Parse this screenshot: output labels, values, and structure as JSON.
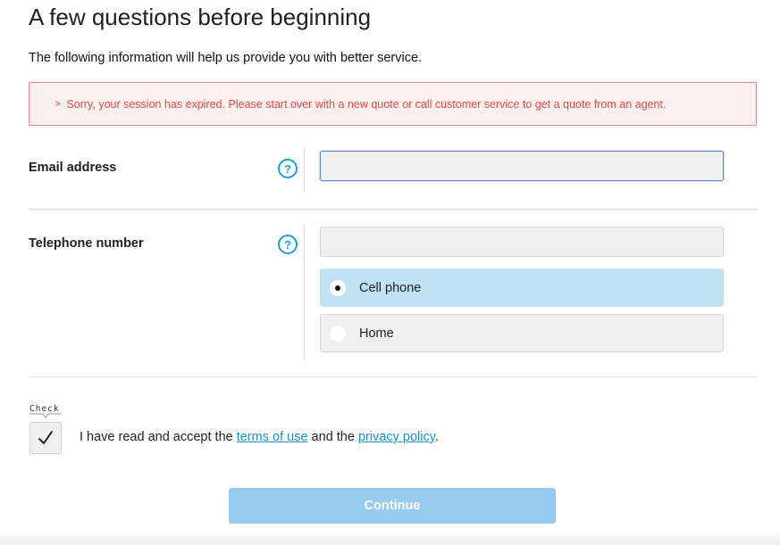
{
  "header": {
    "title": "A few questions before beginning",
    "intro": "The following information will help us provide you with better service."
  },
  "alert": {
    "message": "Sorry, your session has expired. Please start over with a new quote or call customer service to get a quote from an agent.",
    "color": "#e24a4a"
  },
  "email": {
    "label": "Email address",
    "value": "",
    "help_icon": "question-circle-icon"
  },
  "phone": {
    "label": "Telephone number",
    "value": "",
    "help_icon": "question-circle-icon",
    "options": [
      {
        "label": "Cell phone",
        "selected": true
      },
      {
        "label": "Home",
        "selected": false
      }
    ]
  },
  "consent": {
    "tag": "Check",
    "checked": true,
    "text_before": "I have read and accept the ",
    "terms_link": "terms of use",
    "text_middle": " and the ",
    "privacy_link": "privacy policy",
    "text_after": "."
  },
  "actions": {
    "continue_label": "Continue",
    "accent": "#95cbee"
  }
}
